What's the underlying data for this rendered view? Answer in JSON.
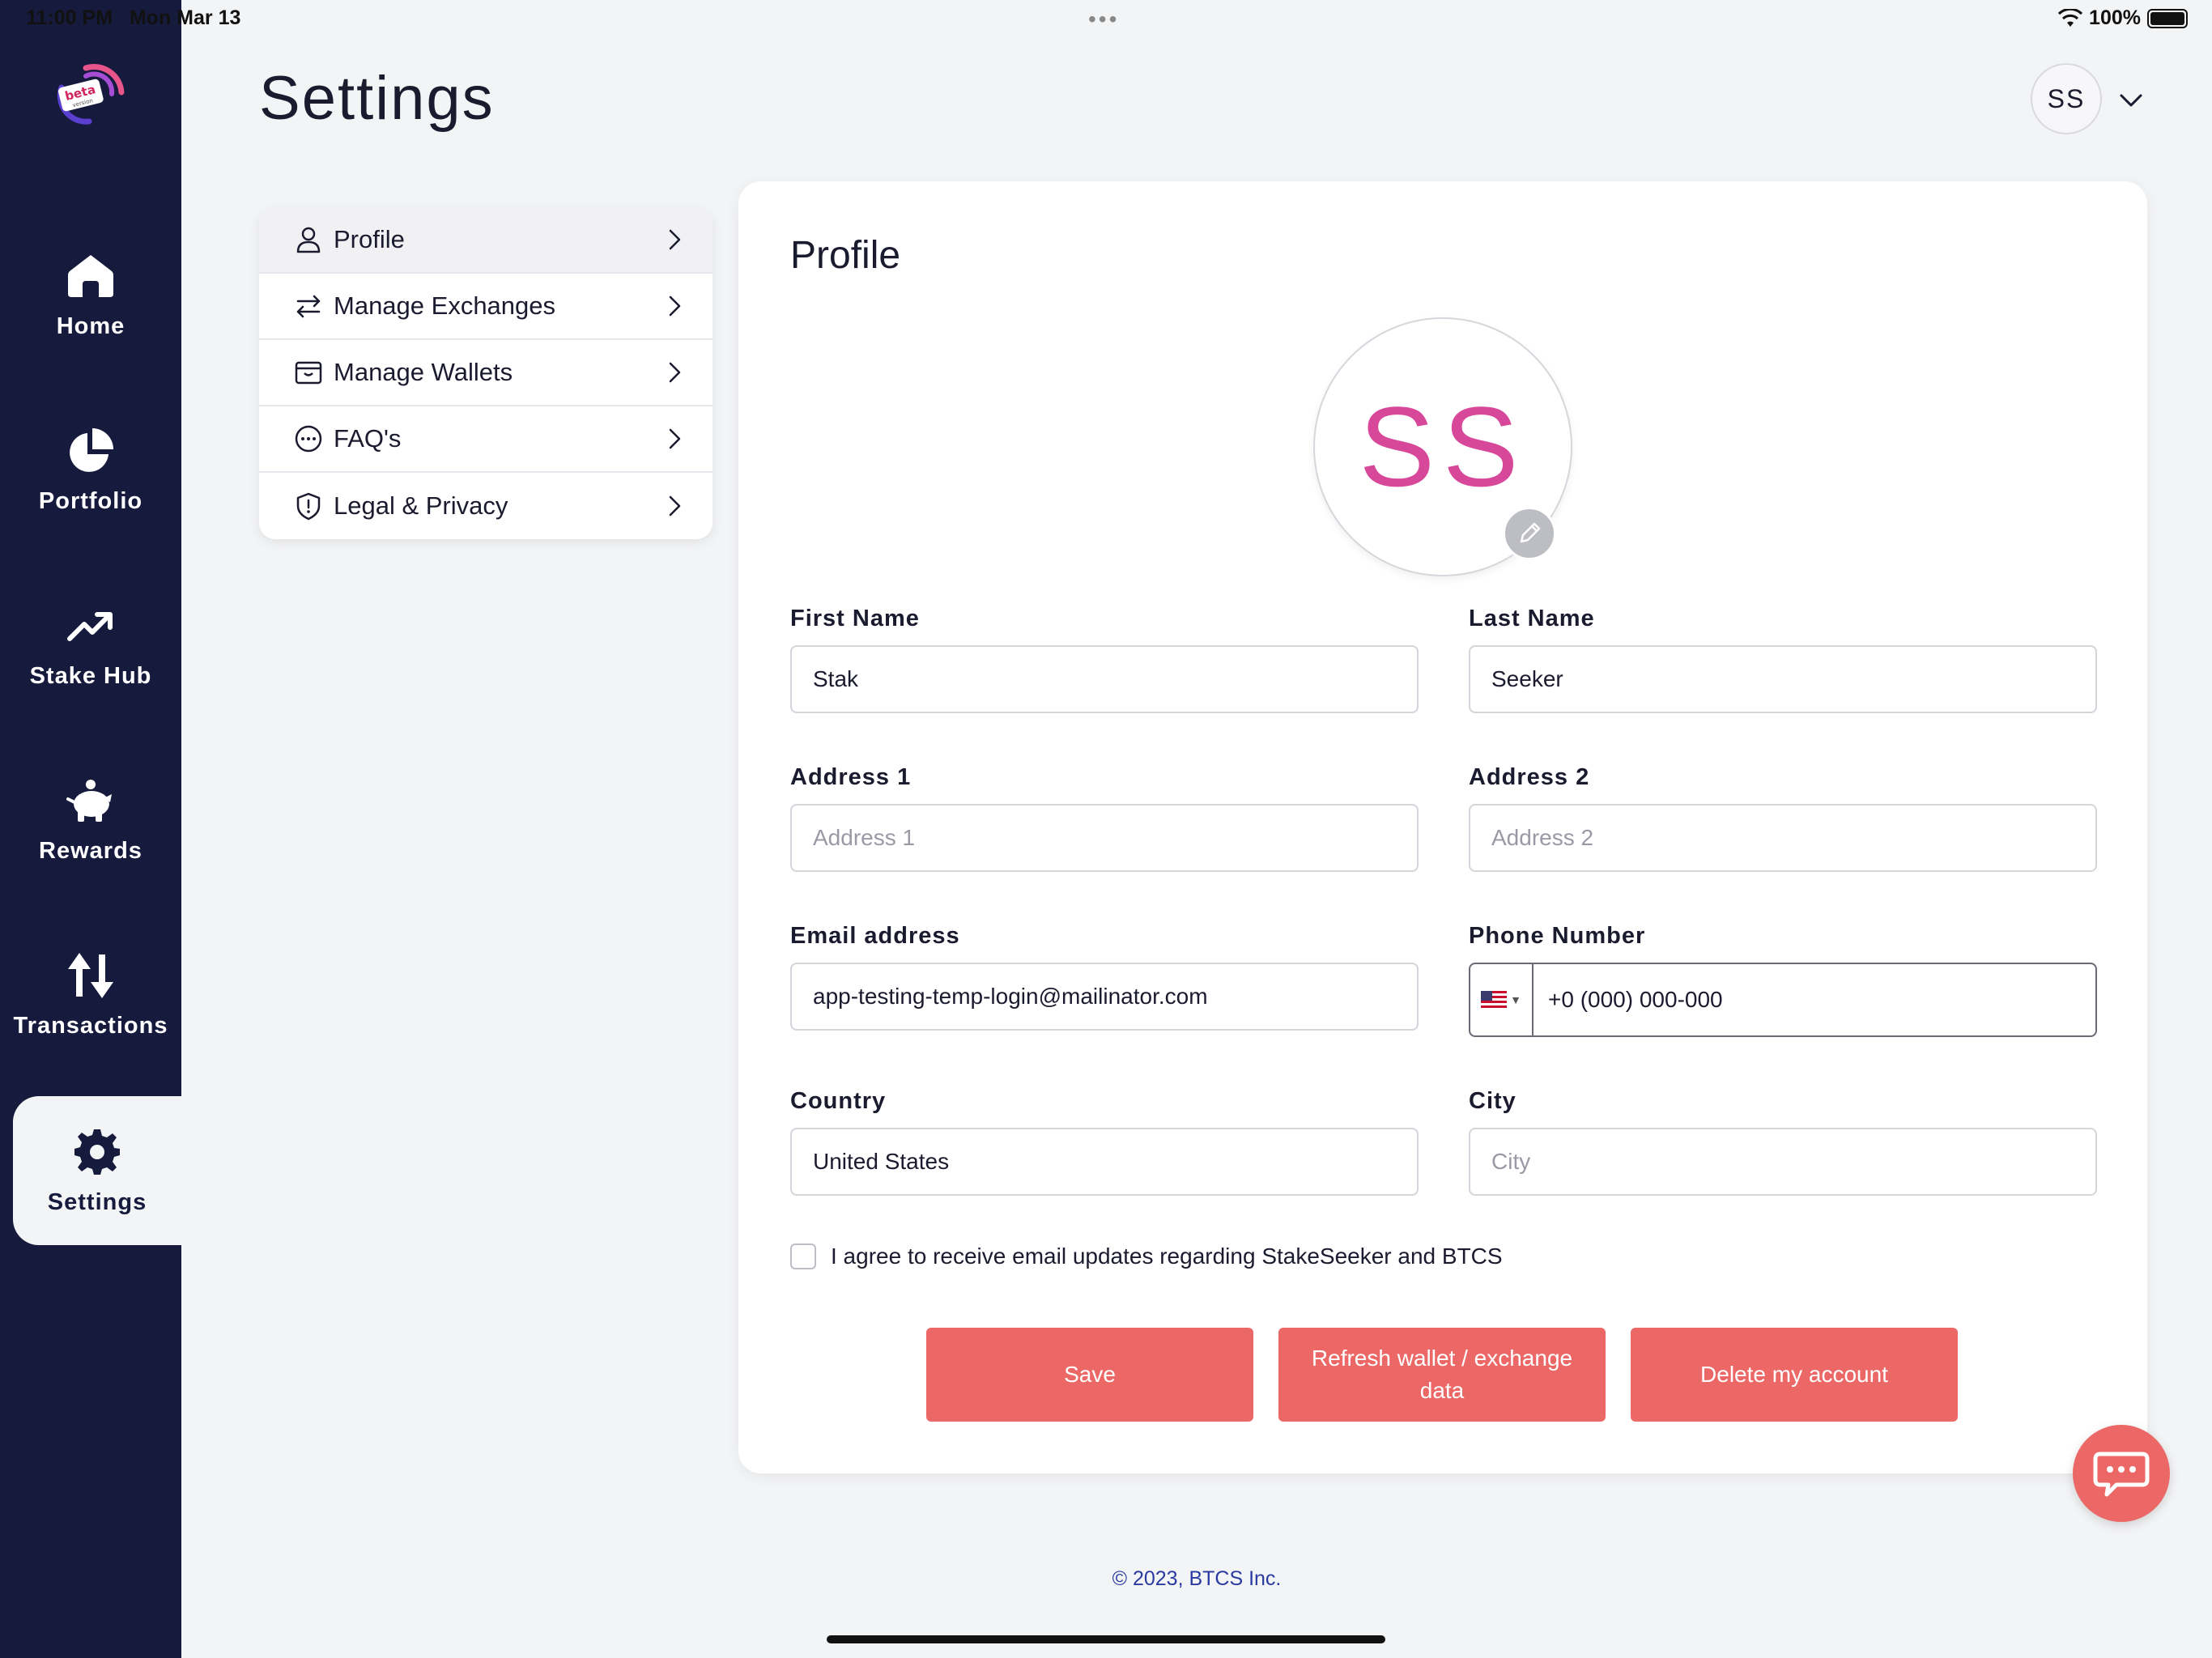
{
  "status_bar": {
    "time": "11:00 PM",
    "date": "Mon Mar 13",
    "battery": "100%"
  },
  "sidebar": {
    "logo_text": "beta",
    "items": [
      {
        "label": "Home",
        "icon": "home-icon",
        "active": false
      },
      {
        "label": "Portfolio",
        "icon": "pie-chart-icon",
        "active": false
      },
      {
        "label": "Stake Hub",
        "icon": "trending-up-icon",
        "active": false
      },
      {
        "label": "Rewards",
        "icon": "piggy-bank-icon",
        "active": false
      },
      {
        "label": "Transactions",
        "icon": "transfer-arrows-icon",
        "active": false
      },
      {
        "label": "Settings",
        "icon": "gear-icon",
        "active": true
      }
    ]
  },
  "header": {
    "title": "Settings",
    "avatar_initials": "SS"
  },
  "settings_menu": {
    "items": [
      {
        "label": "Profile",
        "icon": "user-icon",
        "active": true
      },
      {
        "label": "Manage Exchanges",
        "icon": "swap-icon"
      },
      {
        "label": "Manage Wallets",
        "icon": "wallet-icon"
      },
      {
        "label": "FAQ's",
        "icon": "chat-dots-icon"
      },
      {
        "label": "Legal & Privacy",
        "icon": "shield-icon"
      }
    ]
  },
  "profile": {
    "title": "Profile",
    "avatar_initials": "SS",
    "fields": {
      "first_name": {
        "label": "First Name",
        "value": "Stak"
      },
      "last_name": {
        "label": "Last Name",
        "value": "Seeker"
      },
      "address1": {
        "label": "Address 1",
        "placeholder": "Address 1"
      },
      "address2": {
        "label": "Address 2",
        "placeholder": "Address 2"
      },
      "email": {
        "label": "Email address",
        "value": "app-testing-temp-login@mailinator.com"
      },
      "phone": {
        "label": "Phone Number",
        "value": "+0 (000) 000-000",
        "country_flag": "us-flag-icon"
      },
      "country": {
        "label": "Country",
        "value": "United States"
      },
      "city": {
        "label": "City",
        "placeholder": "City"
      }
    },
    "agree_text": "I agree to receive email updates regarding StakeSeeker and BTCS",
    "agree_checked": false,
    "buttons": {
      "save": "Save",
      "refresh": "Refresh wallet / exchange data",
      "delete": "Delete my account"
    }
  },
  "footer": {
    "copyright": "© 2023, BTCS Inc."
  },
  "colors": {
    "sidebar_bg": "#161a3d",
    "accent": "#ec6866",
    "avatar_text": "#d8489a",
    "page_bg": "#f3f4f6"
  }
}
